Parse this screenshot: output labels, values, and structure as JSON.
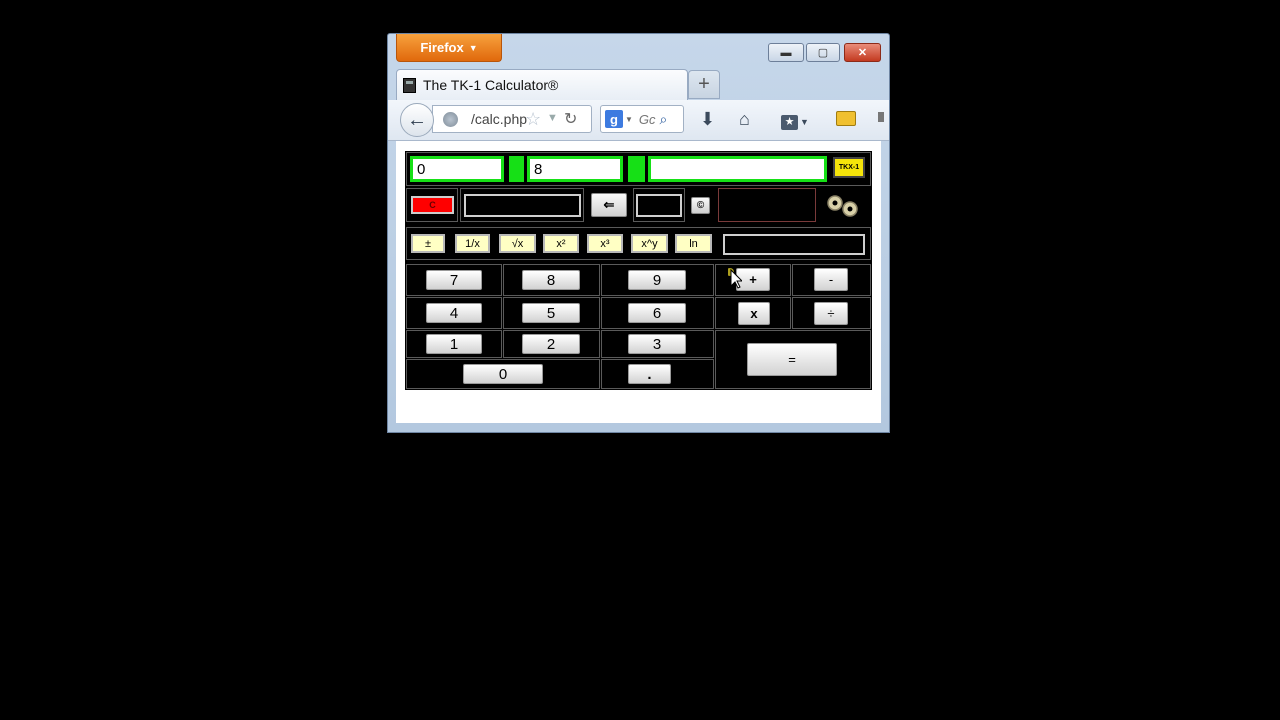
{
  "browser": {
    "menu_label": "Firefox",
    "menu_caret": "▼",
    "window_controls": {
      "minimize": "▬",
      "maximize": "▢",
      "close": "✕"
    },
    "tab_title": "The TK-1 Calculator®",
    "new_tab": "+",
    "url": "/calc.php",
    "search_engine_icon": "g",
    "search_placeholder": "Gc",
    "bookmark_glyph": "★"
  },
  "calculator": {
    "display_1": "0",
    "display_2": "8",
    "display_3": "",
    "logo_text": "TKX-1",
    "clear_label": "C",
    "backspace_label": "⇐",
    "memory_label": "©",
    "function_keys": [
      "±",
      "1/x",
      "√x",
      "x²",
      "x³",
      "x^y",
      "ln"
    ],
    "digit_keys": {
      "k7": "7",
      "k8": "8",
      "k9": "9",
      "k4": "4",
      "k5": "5",
      "k6": "6",
      "k1": "1",
      "k2": "2",
      "k3": "3",
      "k0": "0",
      "dot": "."
    },
    "operator_keys": {
      "plus": "+",
      "minus": "-",
      "times": "x",
      "divide": "÷",
      "equals": "="
    }
  }
}
